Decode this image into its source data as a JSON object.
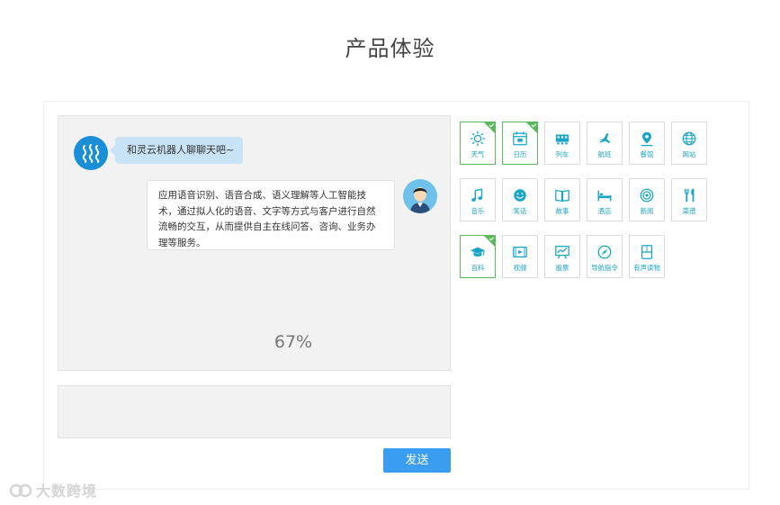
{
  "page": {
    "title": "产品体验"
  },
  "chat": {
    "bot_message": "和灵云机器人聊聊天吧~",
    "user_message": "应用语音识别、语音合成、语义理解等人工智能技术，通过拟人化的语音、文字等方式与客户进行自然流畅的交互，从而提供自主在线问答、咨询、业务办理等服务。",
    "progress": "67%"
  },
  "input": {
    "value": "",
    "send_label": "发送"
  },
  "tiles": [
    {
      "label": "天气",
      "icon": "sun-icon",
      "active": true
    },
    {
      "label": "日历",
      "icon": "calendar-icon",
      "active": true
    },
    {
      "label": "列车",
      "icon": "train-icon",
      "active": false
    },
    {
      "label": "航班",
      "icon": "plane-icon",
      "active": false
    },
    {
      "label": "餐馆",
      "icon": "location-pin-icon",
      "active": false
    },
    {
      "label": "网站",
      "icon": "globe-icon",
      "active": false
    },
    {
      "label": "音乐",
      "icon": "music-note-icon",
      "active": false
    },
    {
      "label": "笑话",
      "icon": "smiley-icon",
      "active": false
    },
    {
      "label": "故事",
      "icon": "book-icon",
      "active": false
    },
    {
      "label": "酒店",
      "icon": "bed-icon",
      "active": false
    },
    {
      "label": "新闻",
      "icon": "target-icon",
      "active": false
    },
    {
      "label": "菜谱",
      "icon": "fork-knife-icon",
      "active": false
    },
    {
      "label": "百科",
      "icon": "graduation-cap-icon",
      "active": true
    },
    {
      "label": "视频",
      "icon": "video-icon",
      "active": false
    },
    {
      "label": "股票",
      "icon": "chart-icon",
      "active": false
    },
    {
      "label": "导航指令",
      "icon": "compass-icon",
      "active": false
    },
    {
      "label": "有声读物",
      "icon": "audiobook-icon",
      "active": false
    }
  ],
  "colors": {
    "accent": "#3a9df0",
    "icon": "#1aa5c8",
    "active_border": "#5cb85c"
  },
  "watermark": {
    "text": "大数跨境"
  }
}
